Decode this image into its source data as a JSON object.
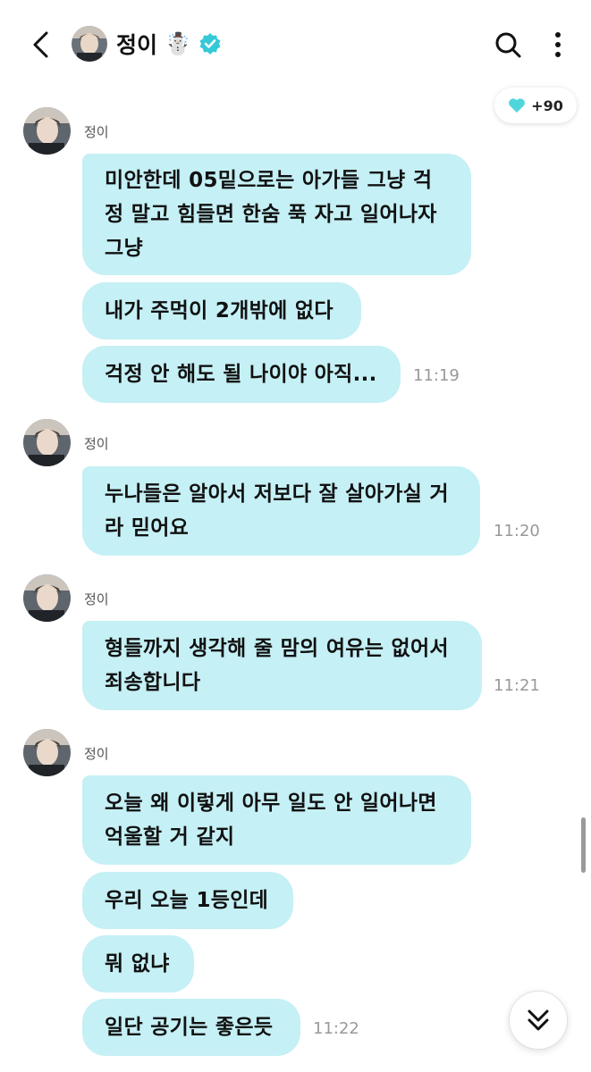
{
  "header": {
    "name": "정이",
    "emoji": "☃️"
  },
  "heart_badge": {
    "count": "+90"
  },
  "groups": [
    {
      "sender": "정이",
      "messages": [
        "미안한데 05밑으로는 아가들 그냥 걱정 말고 힘들면 한숨 푹 자고 일어나자 그냥",
        "내가 주먹이 2개밖에 없다",
        "걱정 안 해도 될 나이야 아직..."
      ],
      "time": "11:19"
    },
    {
      "sender": "정이",
      "messages": [
        "누나들은 알아서 저보다 잘 살아가실 거라 믿어요"
      ],
      "time": "11:20"
    },
    {
      "sender": "정이",
      "messages": [
        "형들까지 생각해 줄 맘의 여유는 없어서 죄송합니다"
      ],
      "time": "11:21"
    },
    {
      "sender": "정이",
      "messages": [
        "오늘 왜 이렇게 아무 일도 안 일어나면 억울할 거 같지",
        "우리 오늘 1등인데",
        "뭐 없냐",
        "일단 공기는 좋은듯"
      ],
      "time": "11:22"
    }
  ],
  "colors": {
    "bubble": "#c5f0f5",
    "verified": "#35c9d6",
    "heart": "#4fd6dc"
  },
  "icons": [
    "back-arrow-icon",
    "search-icon",
    "more-vertical-icon",
    "verified-badge-icon",
    "heart-icon",
    "double-chevron-down-icon"
  ]
}
